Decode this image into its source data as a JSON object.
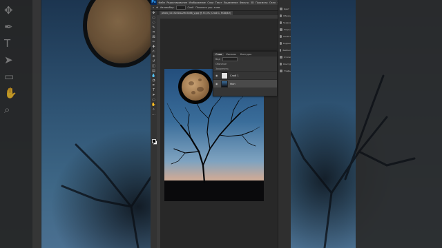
{
  "app": {
    "name": "Photoshop",
    "logo_text": "Ps"
  },
  "menu": [
    "Файл",
    "Редактирование",
    "Изображение",
    "Слои",
    "Текст",
    "Выделение",
    "Фильтр",
    "3D",
    "Просмотр",
    "Окно",
    "Справка"
  ],
  "options_bar": {
    "auto_select_label": "Автовыбор:",
    "layer_dropdown": "Слой",
    "transform_label": "Показать упр. элем."
  },
  "document": {
    "tab_title": "photo_5233030422907088_y.jpg @ 33,3% (Слой 1, RGB/8#)"
  },
  "layers_panel": {
    "tabs": [
      "Слои",
      "Каналы",
      "Контуры"
    ],
    "kind_label": "Вид",
    "blend_label": "Обычные",
    "lock_label": "Закрепить:",
    "layers": [
      {
        "name": "Слой 1",
        "selected": false
      },
      {
        "name": "Фон",
        "selected": true
      }
    ]
  },
  "side_panel": {
    "items": [
      "Цвет",
      "Образцы",
      "Градиенты",
      "Узоры",
      "Свойства",
      "Коррекция",
      "Библиотеки",
      "Стили",
      "Контуры",
      "Глифы"
    ]
  },
  "colors": {
    "accent": "#31a8ff",
    "ui_bg": "#282828",
    "panel_bg": "#353535"
  }
}
